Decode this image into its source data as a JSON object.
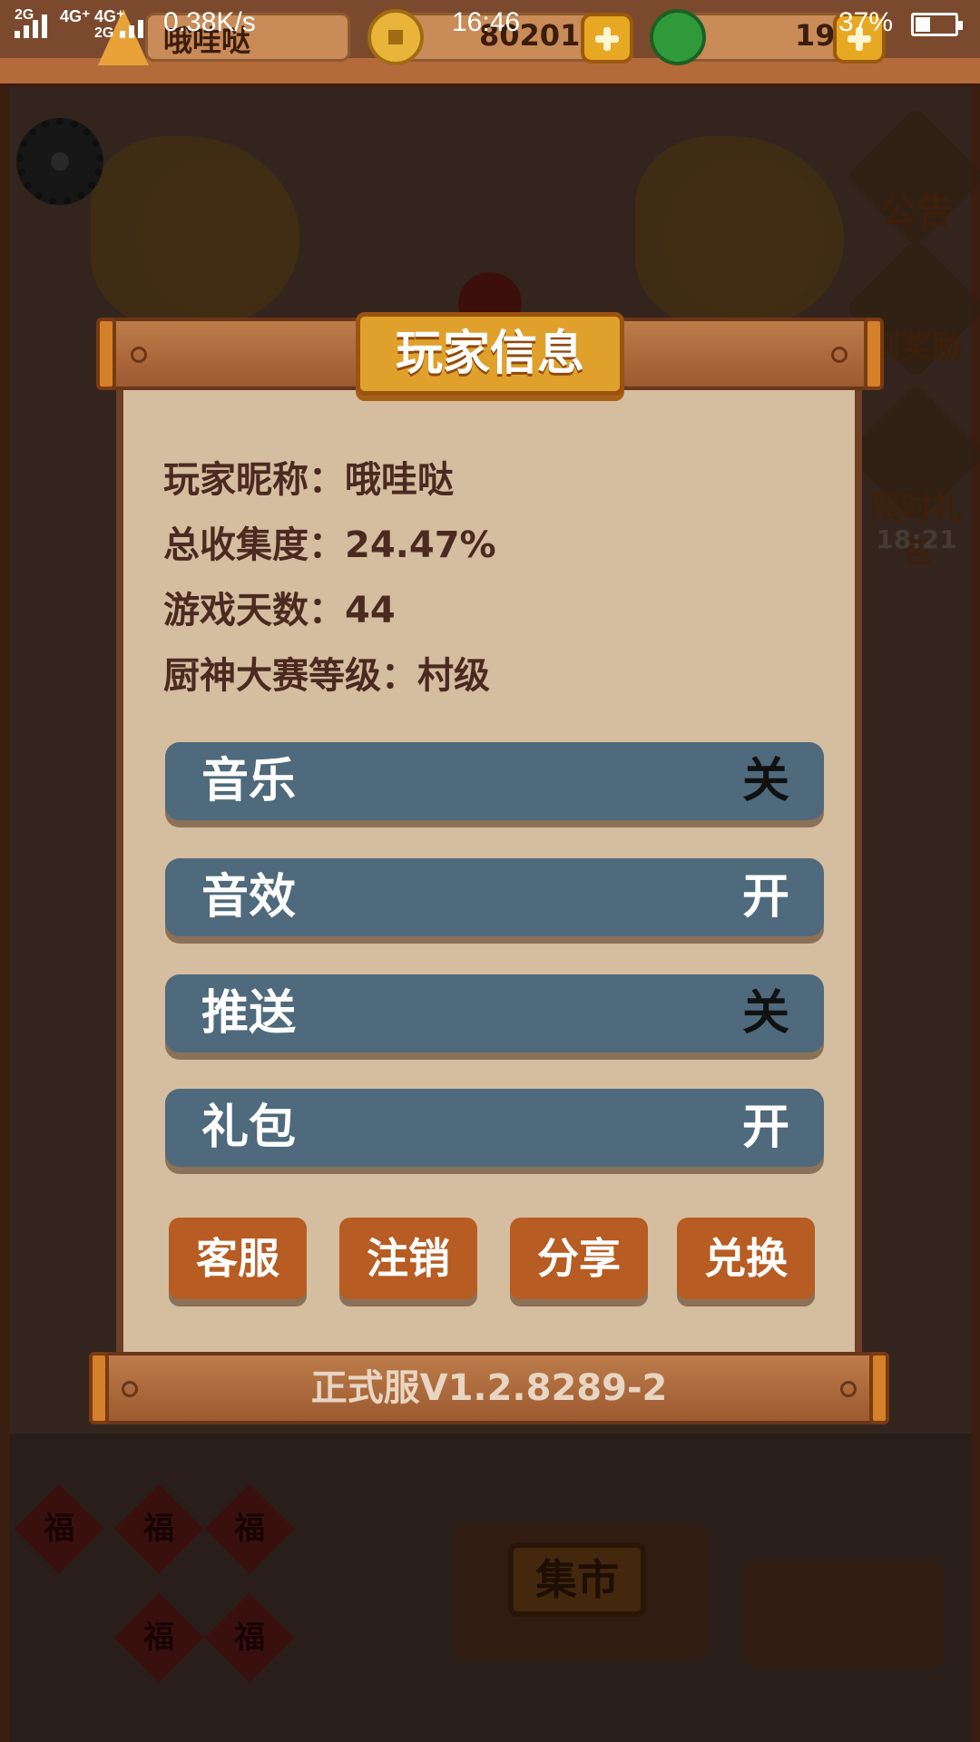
{
  "status_bar": {
    "network_1": "2G",
    "network_2": "4G⁺",
    "network_3": "4G⁺",
    "network_4": "2G",
    "speed": "0.38K/s",
    "time": "16:46",
    "battery": "37%"
  },
  "resources": {
    "player_name": "哦哇哒",
    "coins": "80201",
    "jade": "19"
  },
  "background": {
    "announcement_label": "公告",
    "gift_label": "限时礼包",
    "sign_in_label": "到奖励",
    "timer": "18:21",
    "market_sign": "集市",
    "fu_char": "福"
  },
  "dialog": {
    "title": "玩家信息",
    "info": {
      "nickname": "玩家昵称：哦哇哒",
      "collection": "总收集度：24.47%",
      "days": "游戏天数：44",
      "chef_level": "厨神大赛等级：村级"
    },
    "toggles": [
      {
        "label": "音乐",
        "state": "关"
      },
      {
        "label": "音效",
        "state": "开"
      },
      {
        "label": "推送",
        "state": "关"
      },
      {
        "label": "礼包",
        "state": "开"
      }
    ],
    "buttons": {
      "support": "客服",
      "logout": "注销",
      "share": "分享",
      "redeem": "兑换"
    },
    "version": "正式服V1.2.8289-2"
  }
}
